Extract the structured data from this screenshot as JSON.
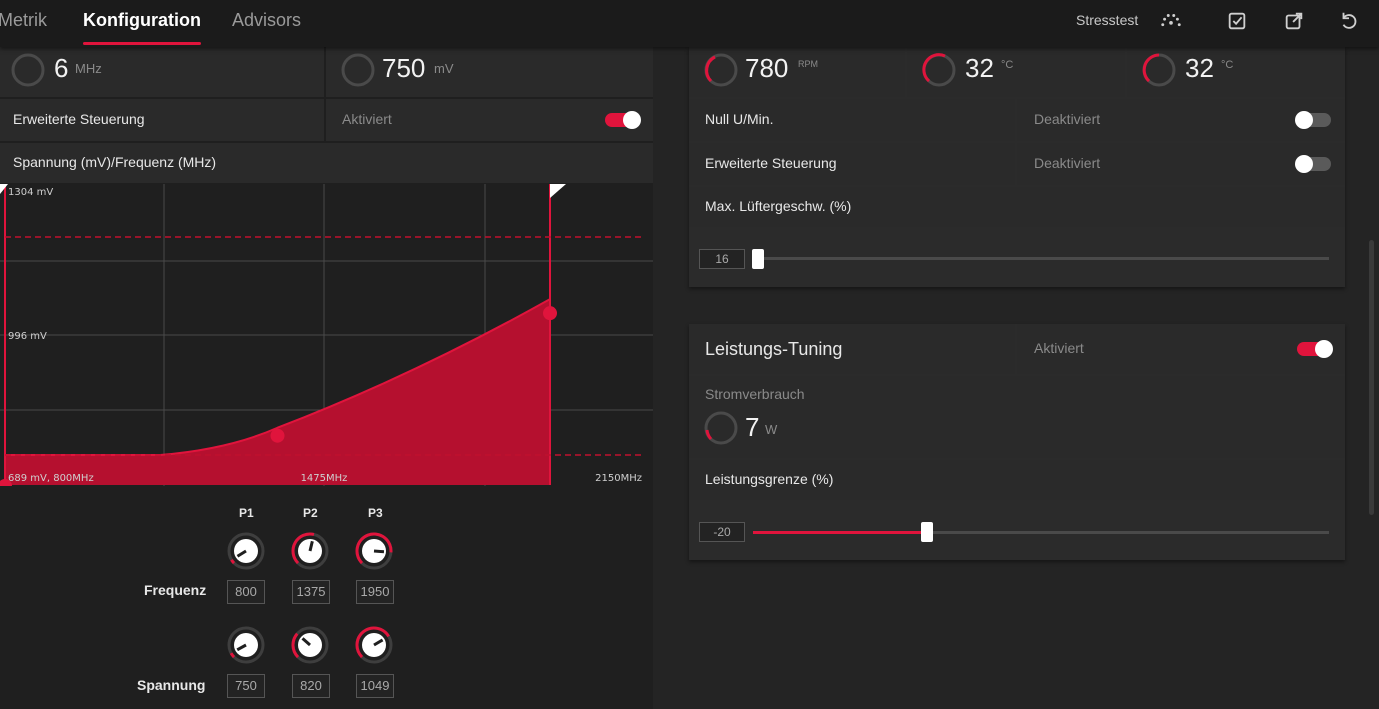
{
  "nav": {
    "tabs": [
      {
        "label": "Metrik"
      },
      {
        "label": "Konfiguration"
      },
      {
        "label": "Advisors"
      }
    ],
    "stresstest_label": "Stresstest"
  },
  "left": {
    "gauges": [
      {
        "value": "6",
        "unit": "MHz"
      },
      {
        "value": "750",
        "unit": "mV"
      }
    ],
    "advanced_control": {
      "label": "Erweiterte Steuerung",
      "status": "Aktiviert",
      "enabled": true
    },
    "vf_curve_title": "Spannung (mV)/Frequenz (MHz)",
    "chart_data": {
      "type": "area",
      "title": "Spannung (mV)/Frequenz (MHz)",
      "y_tick_labels": [
        "1304 mV",
        "996 mV"
      ],
      "x_tick_labels": [
        "689 mV, 800MHz",
        "1475MHz",
        "2150MHz"
      ],
      "points": [
        {
          "name": "P1",
          "freq_mhz": 800,
          "voltage_mv": 750
        },
        {
          "name": "P2",
          "freq_mhz": 1375,
          "voltage_mv": 820
        },
        {
          "name": "P3",
          "freq_mhz": 1950,
          "voltage_mv": 1049
        }
      ],
      "xlim": [
        800,
        2150
      ],
      "ylim": [
        689,
        1304
      ],
      "color": "#e0143c"
    },
    "point_headers": [
      "P1",
      "P2",
      "P3"
    ],
    "frequenz": {
      "label": "Frequenz",
      "values": [
        "800",
        "1375",
        "1950"
      ]
    },
    "spannung": {
      "label": "Spannung",
      "values": [
        "750",
        "820",
        "1049"
      ]
    }
  },
  "right": {
    "gauges": [
      {
        "value": "780",
        "unit": "RPM"
      },
      {
        "value": "32",
        "unit": "°C"
      },
      {
        "value": "32",
        "unit": "°C"
      }
    ],
    "zero_rpm": {
      "label": "Null U/Min.",
      "status": "Deaktiviert",
      "enabled": false
    },
    "fan_advanced": {
      "label": "Erweiterte Steuerung",
      "status": "Deaktiviert",
      "enabled": false
    },
    "max_fan": {
      "label": "Max. Lüftergeschw. (%)",
      "value": "16"
    },
    "perf_tuning": {
      "label": "Leistungs-Tuning",
      "status": "Aktiviert",
      "enabled": true
    },
    "power": {
      "label": "Stromverbrauch",
      "value": "7",
      "unit": "W"
    },
    "power_limit": {
      "label": "Leistungsgrenze (%)",
      "value": "-20"
    }
  },
  "colors": {
    "accent": "#e0143c",
    "bg": "#272727"
  }
}
